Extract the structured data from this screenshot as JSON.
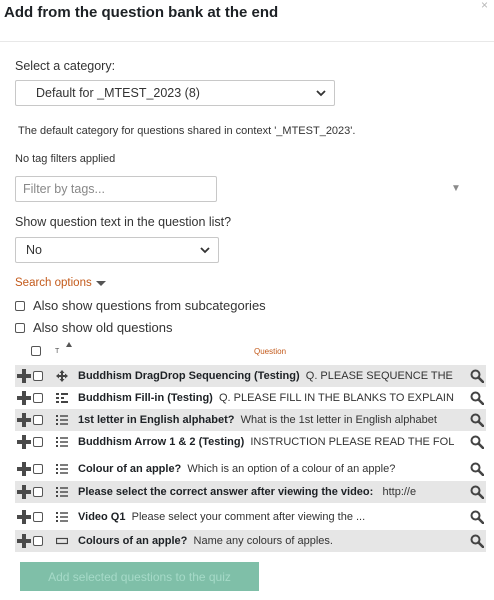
{
  "modal": {
    "title": "Add from the question bank at the end",
    "close_glyph": "×"
  },
  "category": {
    "label": "Select a category:",
    "selected": "Default for _MTEST_2023 (8)",
    "description": "The default category for questions shared in context '_MTEST_2023'."
  },
  "tags": {
    "status": "No tag filters applied",
    "placeholder": "Filter by tags...",
    "dropdown_glyph": "▼"
  },
  "show_text": {
    "label": "Show question text in the question list?",
    "selected": "No"
  },
  "search_options": {
    "label": "Search options",
    "options": [
      {
        "label": "Also show questions from subcategories",
        "checked": false
      },
      {
        "label": "Also show old questions",
        "checked": false
      }
    ]
  },
  "table": {
    "type_header": "T",
    "question_header": "Question",
    "rows": [
      {
        "name": "Buddhism DragDrop Sequencing (Testing)",
        "text": "Q. PLEASE SEQUENCE THE",
        "icon": "move-arrows-icon"
      },
      {
        "name": "Buddhism Fill-in (Testing)",
        "text": "Q. PLEASE FILL IN THE BLANKS TO EXPLAIN",
        "icon": "grid-list-icon"
      },
      {
        "name": "1st letter in English alphabet?",
        "text": "What is the 1st letter in English alphabet",
        "icon": "multichoice-list-icon"
      },
      {
        "name": "Buddhism Arrow 1 & 2 (Testing)",
        "text": "INSTRUCTION PLEASE READ THE FOL",
        "icon": "multichoice-list-icon"
      },
      {
        "name": "Colour of an apple?",
        "text": "Which is an option of a colour of an apple?",
        "icon": "multichoice-list-icon"
      },
      {
        "name": "Please select the correct answer after viewing the video:",
        "text": "http://e",
        "icon": "multichoice-list-icon"
      },
      {
        "name": "Video Q1",
        "text": "Please select your comment after viewing the ...",
        "icon": "multichoice-list-icon"
      },
      {
        "name": "Colours of an apple?",
        "text": "Name any colours of apples.",
        "icon": "short-answer-icon"
      }
    ]
  },
  "add_button": {
    "label": "Add selected questions to the quiz"
  },
  "colors": {
    "accent_orange": "#c35a1b",
    "button_green": "#7fbfa8",
    "row_alt": "#e6e6e6"
  }
}
